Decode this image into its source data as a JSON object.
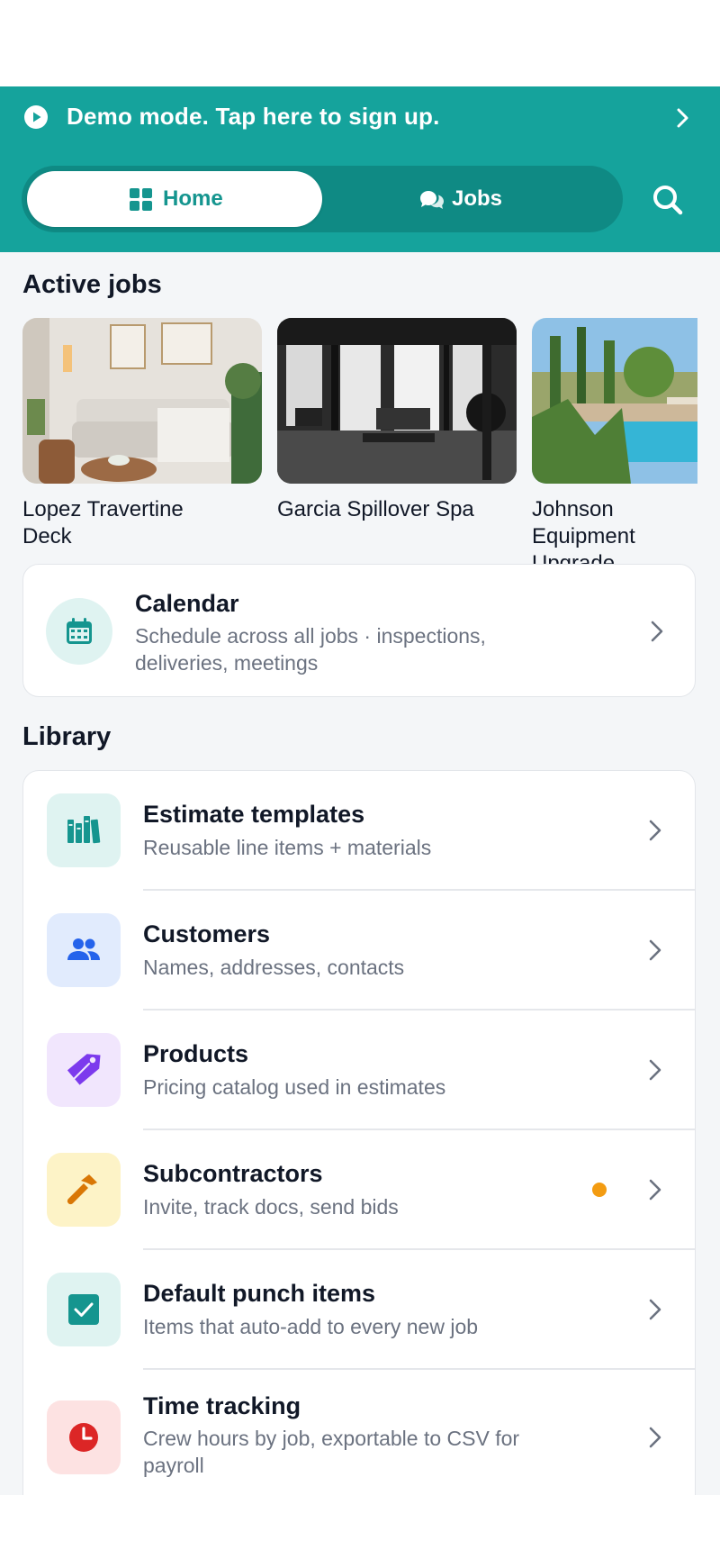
{
  "demo_banner": {
    "text": "Demo mode. Tap here to sign up."
  },
  "segmented": {
    "home": "Home",
    "jobs": "Jobs"
  },
  "active_jobs": {
    "title": "Active jobs",
    "items": [
      {
        "name": "Lopez Travertine\nDeck",
        "thumb": "living-room-photo"
      },
      {
        "name": "Garcia Spillover Spa",
        "thumb": "gym-photo"
      },
      {
        "name": "Johnson Equipment\nUpgrade",
        "thumb": "pool-photo"
      }
    ]
  },
  "calendar": {
    "title": "Calendar",
    "subtitle": "Schedule across all jobs · inspections, deliveries, meetings"
  },
  "library": {
    "title": "Library",
    "items": [
      {
        "title": "Estimate templates",
        "subtitle": "Reusable line items + materials",
        "icon": "books-icon",
        "bg": "#dff3f1"
      },
      {
        "title": "Customers",
        "subtitle": "Names, addresses, contacts",
        "icon": "people-icon",
        "bg": "#e1ebfd"
      },
      {
        "title": "Products",
        "subtitle": "Pricing catalog used in estimates",
        "icon": "tag-icon",
        "bg": "#f1e6fd"
      },
      {
        "title": "Subcontractors",
        "subtitle": "Invite, track docs, send bids",
        "icon": "hammer-icon",
        "bg": "#fdf3c7",
        "notification": true
      },
      {
        "title": "Default punch items",
        "subtitle": "Items that auto-add to every new job",
        "icon": "checkbox-icon",
        "bg": "#dff3f1"
      },
      {
        "title": "Time tracking",
        "subtitle": "Crew hours by job, exportable to CSV for payroll",
        "icon": "clock-icon",
        "bg": "#fde2e2"
      }
    ]
  },
  "colors": {
    "teal": "#15a39c",
    "teal_dark": "#0f8a84",
    "notification": "#f39c12"
  }
}
